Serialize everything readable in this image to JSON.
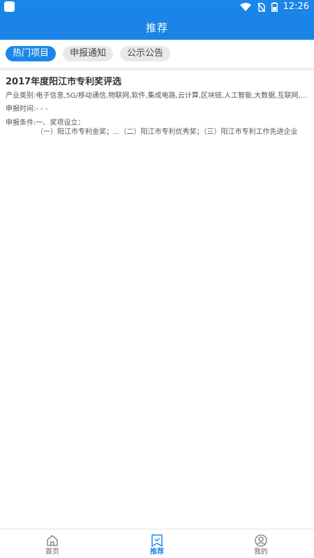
{
  "status": {
    "time": "12:26"
  },
  "header": {
    "title": "推荐"
  },
  "tabs": [
    {
      "label": "热门项目",
      "active": true
    },
    {
      "label": "申报通知",
      "active": false
    },
    {
      "label": "公示公告",
      "active": false
    }
  ],
  "items": [
    {
      "title": "2017年度阳江市专利奖评选",
      "industry": "产业类别:电子信息,5G/移动通信,物联网,软件,集成电路,云计算,区块链,人工智能,大数据,互联网,...",
      "declare_time": "申报时间:- - -",
      "condition_head": "申报条件:一、奖项设立：",
      "condition_body": "（一）阳江市专利金奖；...（二）阳江市专利优秀奖；（三）阳江市专利工作先进企业"
    }
  ],
  "bottom_nav": [
    {
      "label": "首页",
      "icon": "home-icon",
      "active": false
    },
    {
      "label": "推荐",
      "icon": "bookmark-icon",
      "active": true
    },
    {
      "label": "我的",
      "icon": "user-icon",
      "active": false
    }
  ],
  "colors": {
    "primary": "#1c87ea",
    "tab_inactive": "#e9e9e9",
    "text": "#333333"
  }
}
